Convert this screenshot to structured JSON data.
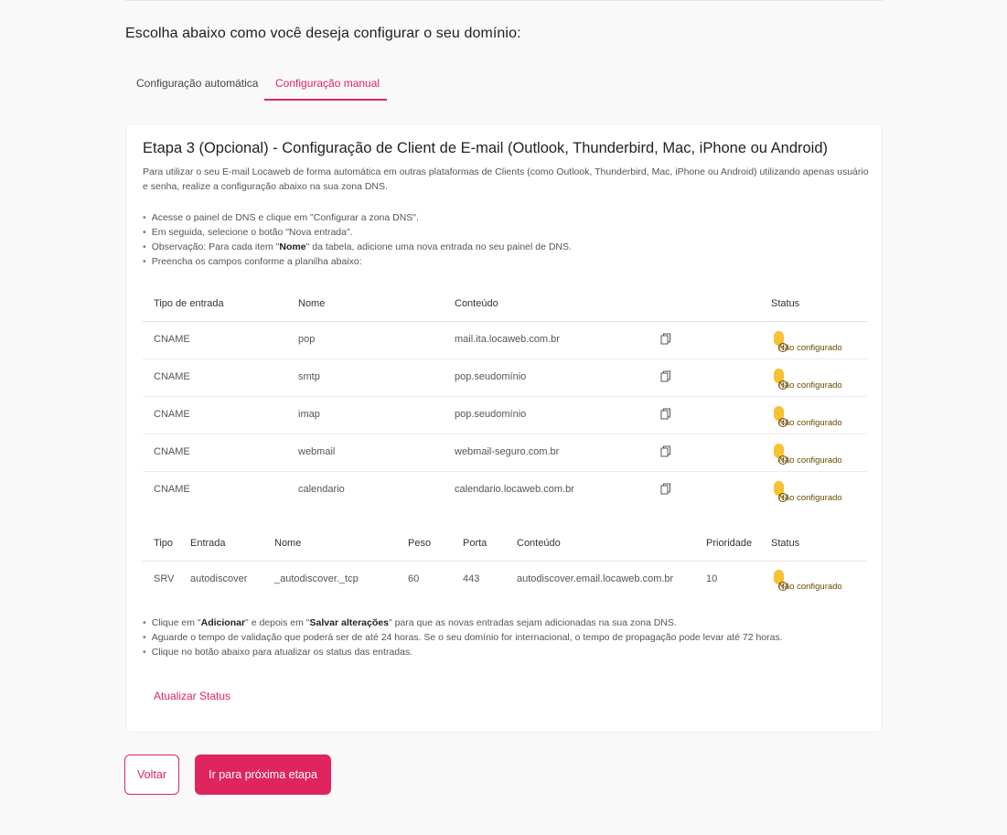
{
  "heading": "Escolha abaixo como você deseja configurar o seu domínio:",
  "tabs": [
    {
      "label": "Configuração automática",
      "active": false
    },
    {
      "label": "Configuração manual",
      "active": true
    }
  ],
  "card": {
    "title": "Etapa 3 (Opcional) - Configuração de Client de E-mail (Outlook, Thunderbird, Mac, iPhone ou Android)",
    "description": "Para utilizar o seu E-mail Locaweb de forma automática em outras plataformas de Clients (como Outlook, Thunderbird, Mac, iPhone ou Android) utilizando apenas usuário e senha, realize a configuração abaixo na sua zona DNS.",
    "steps": {
      "s1": "Acesse o painel de DNS e clique em \"Configurar a zona DNS\".",
      "s2": "Em seguida, selecione o botão \"Nova entrada\".",
      "s3_pre": "Observação: Para cada item \"",
      "s3_bold": "Nome",
      "s3_post": "\" da tabela, adicione uma nova entrada no seu painel de DNS.",
      "s4": "Preencha os campos conforme a planilha abaixo:"
    }
  },
  "cname_table": {
    "headers": {
      "tipo": "Tipo de entrada",
      "nome": "Nome",
      "conteudo": "Conteúdo",
      "status": "Status"
    },
    "rows": [
      {
        "tipo": "CNAME",
        "nome": "pop",
        "conteudo": "mail.ita.locaweb.com.br",
        "status": "Não configurado"
      },
      {
        "tipo": "CNAME",
        "nome": "smtp",
        "conteudo": "pop.seudomínio",
        "status": "Não configurado"
      },
      {
        "tipo": "CNAME",
        "nome": "imap",
        "conteudo": "pop.seudomínio",
        "status": "Não configurado"
      },
      {
        "tipo": "CNAME",
        "nome": "webmail",
        "conteudo": "webmail-seguro.com.br",
        "status": "Não configurado"
      },
      {
        "tipo": "CNAME",
        "nome": "calendario",
        "conteudo": "calendario.locaweb.com.br",
        "status": "Não configurado"
      }
    ]
  },
  "srv_table": {
    "headers": {
      "tipo": "Tipo",
      "entrada": "Entrada",
      "nome": "Nome",
      "peso": "Peso",
      "porta": "Porta",
      "conteudo": "Conteúdo",
      "prioridade": "Prioridade",
      "status": "Status"
    },
    "row": {
      "tipo": "SRV",
      "entrada": "autodiscover",
      "nome": "_autodiscover._tcp",
      "peso": "60",
      "porta": "443",
      "conteudo": "autodiscover.email.locaweb.com.br",
      "prioridade": "10",
      "status": "Não configurado"
    }
  },
  "notes": {
    "n1_a": "Clique em \"",
    "n1_b": "Adicionar",
    "n1_c": "\" e depois em \"",
    "n1_d": "Salvar alterações",
    "n1_e": "\" para que as novas entradas sejam adicionadas na sua zona DNS.",
    "n2": "Aguarde o tempo de validação que poderá ser de até 24 horas. Se o seu domínio for internacional, o tempo de propagação pode levar até 72 horas.",
    "n3": "Clique no botão abaixo para atualizar os status das entradas."
  },
  "update_link": "Atualizar Status",
  "buttons": {
    "back": "Voltar",
    "next": "Ir para próxima etapa"
  },
  "colors": {
    "accent": "#e0245e",
    "badge": "#f7c135"
  }
}
